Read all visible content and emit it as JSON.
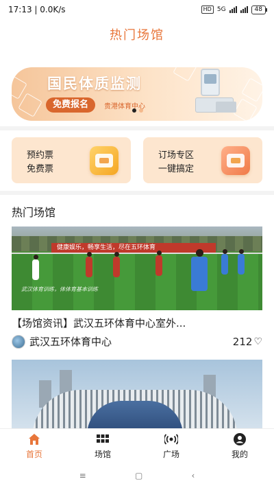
{
  "status_bar": {
    "time_speed": "17:13 | 0.0K/s",
    "hd": "HD",
    "network": "5G",
    "battery": "48"
  },
  "header": {
    "title": "热门场馆"
  },
  "banner": {
    "title": "国民体质监测",
    "button_label": "免费报名",
    "organization": "贵港体育中心",
    "slide_count": 2,
    "active_slide": 1
  },
  "quick_actions": [
    {
      "line1": "预约票",
      "line2": "免费票",
      "icon": "ticket-icon",
      "color": "#f5a623"
    },
    {
      "line1": "订场专区",
      "line2": "一键搞定",
      "icon": "venue-booking-icon",
      "color": "#f07a48"
    }
  ],
  "section": {
    "title": "热门场馆",
    "cards": [
      {
        "title": "【场馆资讯】武汉五环体育中心室外...",
        "venue": "武汉五环体育中心",
        "likes": "212",
        "photo_sign": "健康娱乐，畅享生活，尽在五环体育",
        "photo_watermark": "武汉体育训练，体体育基本训练"
      },
      {
        "title": "",
        "venue": "",
        "likes": ""
      }
    ]
  },
  "tabbar": {
    "items": [
      {
        "label": "首页",
        "icon": "home-icon",
        "active": true
      },
      {
        "label": "场馆",
        "icon": "grid-icon",
        "active": false
      },
      {
        "label": "广场",
        "icon": "broadcast-icon",
        "active": false
      },
      {
        "label": "我的",
        "icon": "user-icon",
        "active": false
      }
    ]
  },
  "system_nav": {
    "menu": "≡",
    "home": "▢",
    "back": "‹"
  },
  "colors": {
    "accent": "#e8763a",
    "card_bg": "#fde6cf"
  }
}
